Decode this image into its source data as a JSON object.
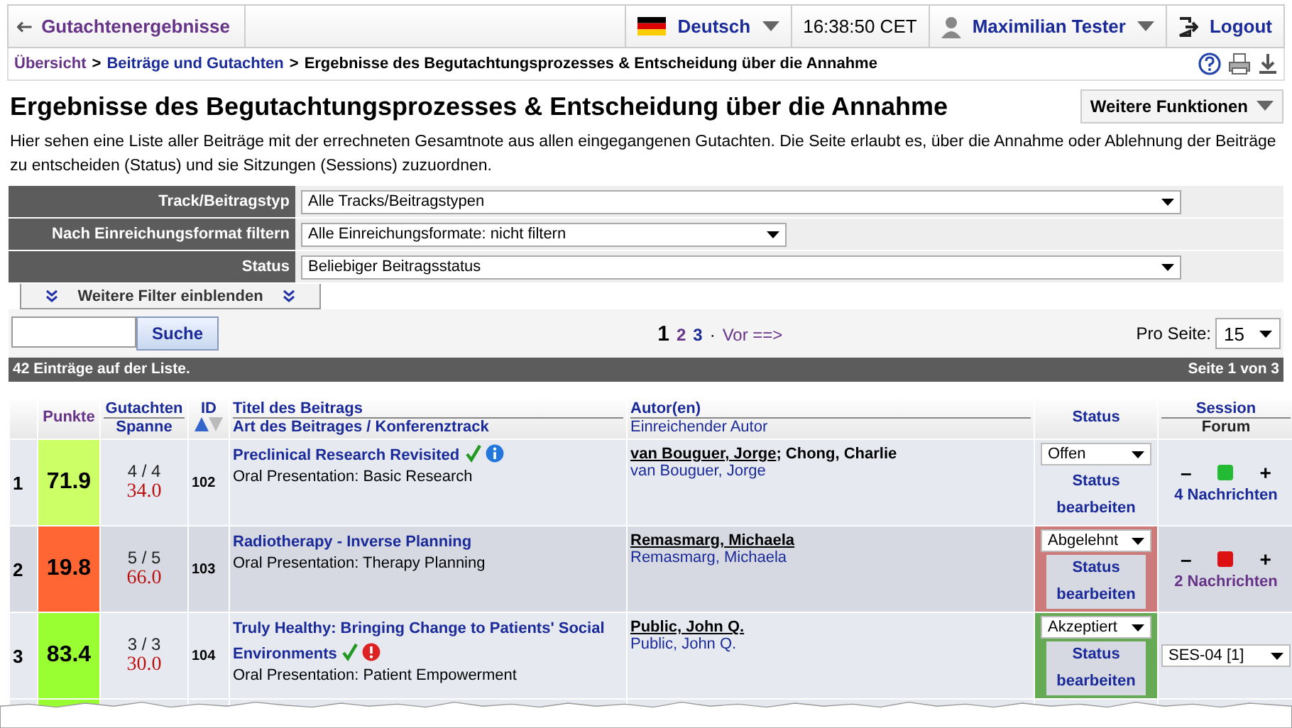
{
  "topbar": {
    "back": "Gutachtenergebnisse",
    "language": "Deutsch",
    "time": "16:38:50 CET",
    "user": "Maximilian Tester",
    "logout": "Logout"
  },
  "breadcrumb": [
    {
      "label": "Übersicht",
      "kind": "visited"
    },
    {
      "separator": ">",
      "label": "Beiträge und Gutachten",
      "kind": "link"
    },
    {
      "separator": ">",
      "label": "Ergebnisse des Begutachtungsprozesses & Entscheidung über die Annahme",
      "kind": "current"
    }
  ],
  "title": "Ergebnisse des Begutachtungsprozesses & Entscheidung über die Annahme",
  "more_button": "Weitere Funktionen",
  "description": "Hier sehen eine Liste aller Beiträge mit der errechneten Gesamtnote aus allen eingegangenen Gutachten. Die Seite erlaubt es, über die Annahme oder Ablehnung der Beiträge zu entscheiden (Status) und sie Sitzungen (Sessions) zuzuordnen.",
  "filters": [
    {
      "label": "Track/Beitragstyp",
      "value": "Alle Tracks/Beitragstypen",
      "kind": "wide"
    },
    {
      "label": "Nach Einreichungsformat filtern",
      "value": "Alle Einreichungsformate: nicht filtern",
      "kind": "narrow"
    },
    {
      "label": "Status",
      "value": "Beliebiger Beitragsstatus",
      "kind": "wide"
    }
  ],
  "more_filters": "Weitere Filter einblenden",
  "search": {
    "button": "Suche"
  },
  "pagination": {
    "pages": [
      {
        "label": "1",
        "selected": true
      },
      {
        "label": "2",
        "selected": false
      },
      {
        "label": "3",
        "selected": false
      }
    ],
    "separator": "·",
    "next": "Vor ==>",
    "per_page_label": "Pro Seite:",
    "per_page": "15"
  },
  "list_bar": {
    "count": "42 Einträge auf der Liste.",
    "page": "Seite 1 von 3"
  },
  "columns": {
    "score": "Punkte",
    "reviews": "Gutachten",
    "spread": "Spanne",
    "id": "ID",
    "title": "Titel des Beitrags",
    "type": "Art des Beitrages / Konferenztrack",
    "authors": "Autor(en)",
    "submitter": "Einreichender Autor",
    "status": "Status",
    "session": "Session",
    "forum": "Forum"
  },
  "rows": [
    {
      "index": "1",
      "score": "71.9",
      "color": "#ccff66",
      "reviews": "4 / 4",
      "spread": "34.0",
      "id": "102",
      "title": [
        "Preclinical Research Revisited"
      ],
      "accepted_mark": true,
      "info": true,
      "alert": false,
      "track": "Oral Presentation: Basic Research",
      "presenter": "van Bouguer, Jorge",
      "coauthors": "; Chong, Charlie",
      "submitter": "van Bouguer, Jorge",
      "status": "Offen",
      "kind": "open",
      "status_link": "Status bearbeiten",
      "forum": {
        "kind": "messages",
        "minus": "–",
        "plus": "+",
        "color": "#22bb33",
        "messages": "4 Nachrichten",
        "visited": false
      }
    },
    {
      "index": "2",
      "score": "19.8",
      "color": "#ff6633",
      "reviews": "5 / 5",
      "spread": "66.0",
      "id": "103",
      "title": [
        "Radiotherapy - Inverse Planning"
      ],
      "accepted_mark": false,
      "info": false,
      "alert": false,
      "track": "Oral Presentation: Therapy Planning",
      "presenter": "Remasmarg, Michaela",
      "submitter": "Remasmarg, Michaela",
      "status": "Abgelehnt",
      "kind": "rejected",
      "status_link": "Status bearbeiten",
      "forum": {
        "kind": "messages",
        "minus": "–",
        "plus": "+",
        "color": "#dd1111",
        "messages": "2 Nachrichten",
        "visited": true
      }
    },
    {
      "index": "3",
      "score": "83.4",
      "color": "#99ff33",
      "reviews": "3 / 3",
      "spread": "30.0",
      "id": "104",
      "title": [
        "Truly Healthy: Bringing Change to Patients' Social",
        "Environments"
      ],
      "accepted_mark": true,
      "info": false,
      "alert": true,
      "track": "Oral Presentation: Patient Empowerment",
      "presenter": "Public, John Q.",
      "submitter": "Public, John Q.",
      "status": "Akzeptiert",
      "kind": "accepted",
      "status_link": "Status bearbeiten",
      "forum": {
        "kind": "session",
        "session": "SES-04 [1]"
      }
    }
  ]
}
